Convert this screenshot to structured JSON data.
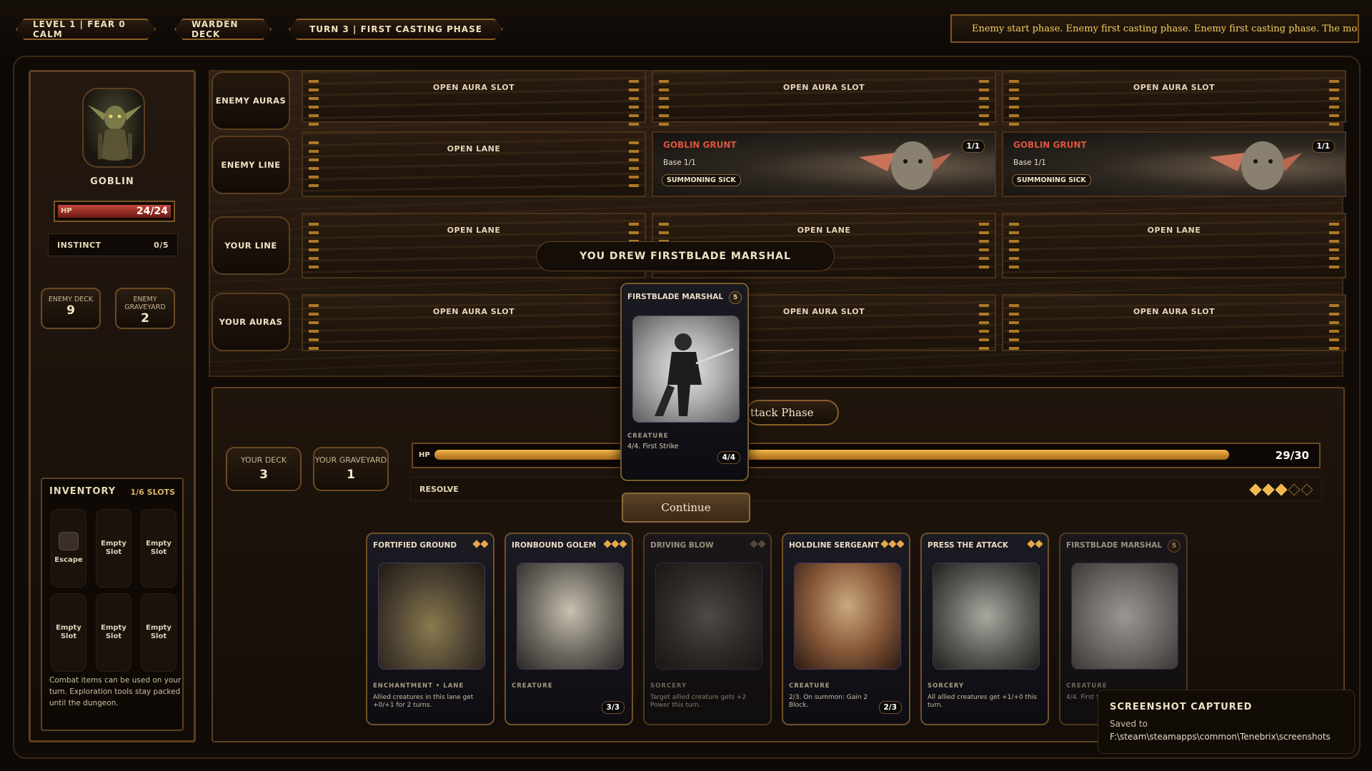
{
  "topbar": {
    "level_pill": "LEVEL 1 | FEAR 0 CALM",
    "deck_pill": "WARDEN DECK",
    "turn_pill": "TURN 3 | FIRST CASTING PHASE",
    "ticker": "Enemy start phase. Enemy first casting phase. Enemy first casting phase. The monst"
  },
  "enemy": {
    "name": "GOBLIN",
    "hp_label": "HP",
    "hp_value": "24/24",
    "hp_fraction": 1.0,
    "instinct_label": "INSTINCT",
    "instinct_value": "0/5",
    "deck_label": "ENEMY DECK",
    "deck_count": "9",
    "graveyard_label": "ENEMY GRAVEYARD",
    "graveyard_count": "2"
  },
  "inventory": {
    "title": "INVENTORY",
    "slots_label": "1/6 SLOTS",
    "slots": [
      "Escape",
      "Empty Slot",
      "Empty Slot",
      "Empty Slot",
      "Empty Slot",
      "Empty Slot"
    ],
    "note": "Combat items can be used on your turn. Exploration tools stay packed until the dungeon."
  },
  "board": {
    "row_labels": [
      "ENEMY AURAS",
      "ENEMY LINE",
      "YOUR LINE",
      "YOUR AURAS"
    ],
    "enemy_auras": [
      "OPEN AURA SLOT",
      "OPEN AURA SLOT",
      "OPEN AURA SLOT"
    ],
    "enemy_line": {
      "open": "OPEN LANE",
      "creatures": [
        {
          "name": "GOBLIN GRUNT",
          "base": "Base 1/1",
          "status": "SUMMONING SICK",
          "pt": "1/1"
        },
        {
          "name": "GOBLIN GRUNT",
          "base": "Base 1/1",
          "status": "SUMMONING SICK",
          "pt": "1/1"
        }
      ]
    },
    "your_line": [
      "OPEN LANE",
      "OPEN LANE",
      "OPEN LANE"
    ],
    "your_auras": [
      "OPEN AURA SLOT",
      "OPEN AURA SLOT",
      "OPEN AURA SLOT"
    ]
  },
  "player": {
    "phase_button": "ttack Phase",
    "deck_label": "YOUR DECK",
    "deck_count": "3",
    "graveyard_label": "YOUR GRAVEYARD",
    "graveyard_count": "1",
    "hp_label": "HP",
    "hp_value": "29/30",
    "hp_fraction": 0.967,
    "resolve_label": "RESOLVE",
    "resolve_filled": 3,
    "resolve_max": 5
  },
  "hand": [
    {
      "name": "FORTIFIED GROUND",
      "cost": 2,
      "type": "ENCHANTMENT • LANE",
      "text": "Allied creatures in this lane get +0/+1 for 2 turns.",
      "pt": ""
    },
    {
      "name": "IRONBOUND GOLEM",
      "cost": 3,
      "type": "CREATURE",
      "text": "",
      "pt": "3/3"
    },
    {
      "name": "DRIVING BLOW",
      "cost": 2,
      "type": "SORCERY",
      "text": "Target allied creature gets +2 Power this turn.",
      "pt": ""
    },
    {
      "name": "HOLDLINE SERGEANT",
      "cost": 3,
      "type": "CREATURE",
      "text": "2/3. On summon: Gain 2 Block.",
      "pt": "2/3"
    },
    {
      "name": "PRESS THE ATTACK",
      "cost": 2,
      "type": "SORCERY",
      "text": "All allied creatures get +1/+0 this turn.",
      "pt": ""
    },
    {
      "name": "FIRSTBLADE MARSHAL",
      "cost": "5",
      "type": "CREATURE",
      "text": "4/4. First S",
      "pt": ""
    }
  ],
  "draw": {
    "banner": "YOU DREW FIRSTBLADE MARSHAL",
    "card_name": "FIRSTBLADE MARSHAL",
    "card_cost": "5",
    "card_type": "CREATURE",
    "card_text": "4/4. First Strike",
    "card_pt": "4/4",
    "continue_label": "Continue"
  },
  "toast": {
    "title": "SCREENSHOT CAPTURED",
    "line1": "Saved to",
    "path": "F:\\steam\\steamapps\\common\\Tenebrix\\screenshots"
  },
  "colors": {
    "accent_gold": "#f2b74a",
    "enemy_name_red": "#d9543f",
    "ticker_yellow": "#f4d35e",
    "hp_red": "#c2453a"
  }
}
